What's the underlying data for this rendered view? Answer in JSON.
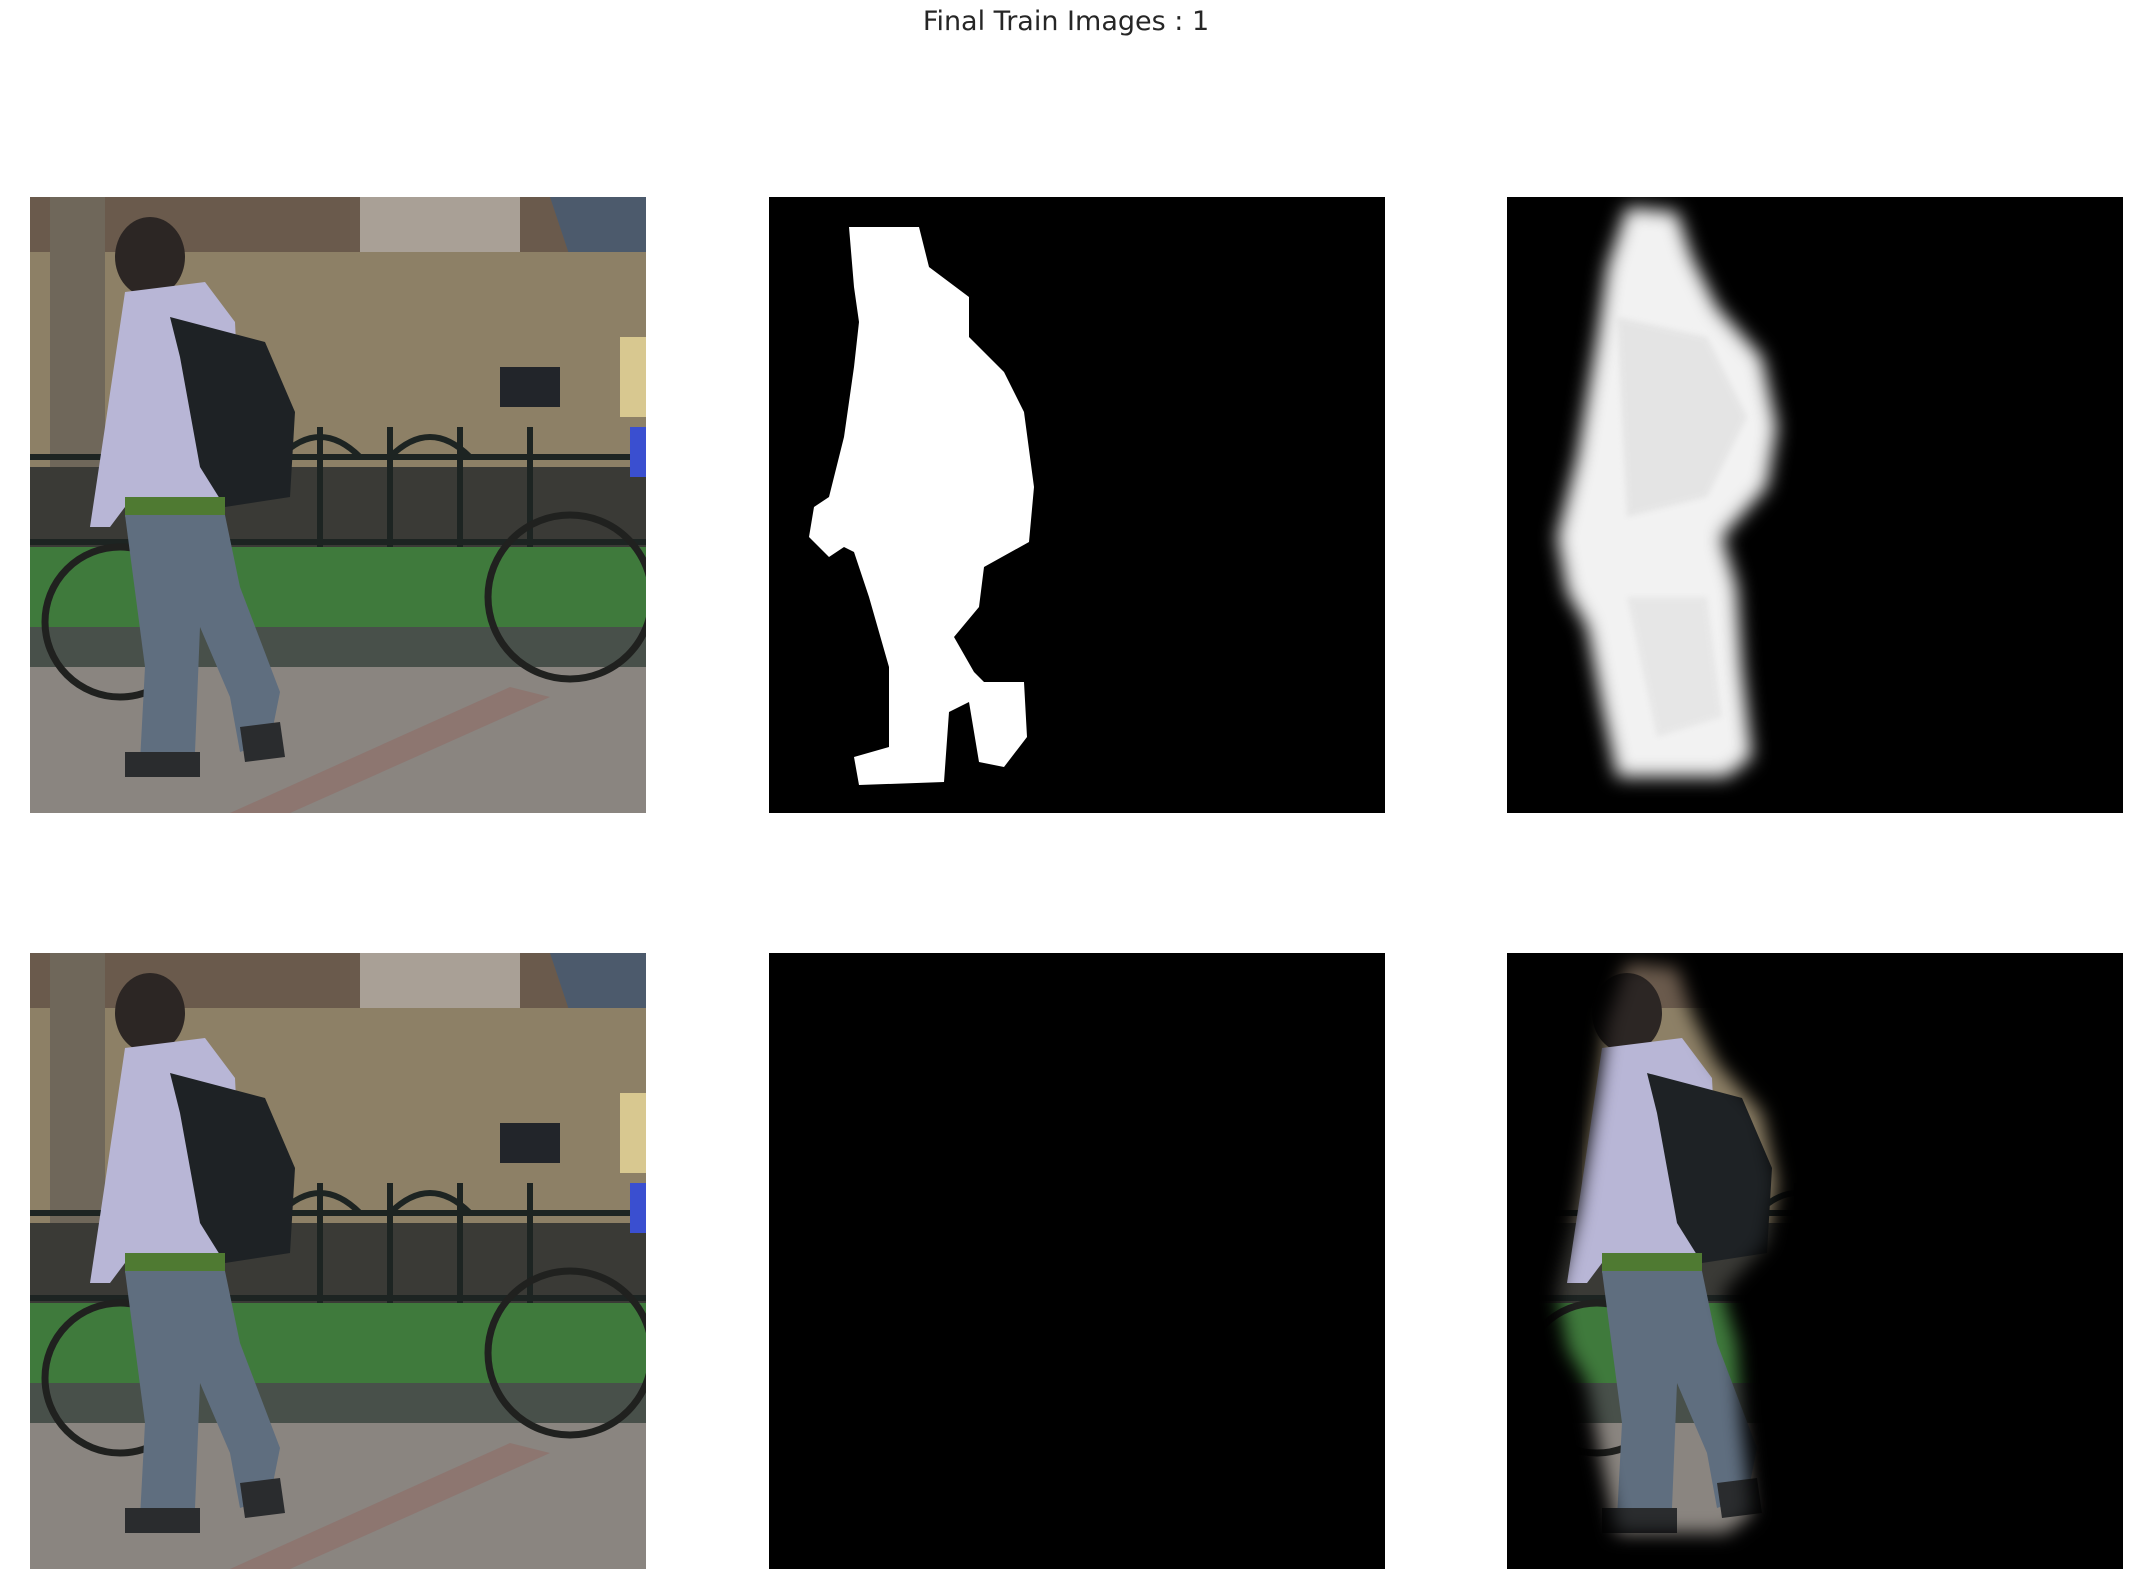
{
  "figure": {
    "title": "Final Train Images : 1"
  },
  "panels": [
    {
      "id": "input-image",
      "row": 1,
      "col": 1,
      "content": "photo"
    },
    {
      "id": "ground-truth-mask",
      "row": 1,
      "col": 2,
      "content": "binary-mask"
    },
    {
      "id": "predicted-mask",
      "row": 1,
      "col": 3,
      "content": "soft-mask"
    },
    {
      "id": "input-image-copy",
      "row": 2,
      "col": 1,
      "content": "photo"
    },
    {
      "id": "ground-truth-cutout",
      "row": 2,
      "col": 2,
      "content": "masked-photo"
    },
    {
      "id": "predicted-cutout",
      "row": 2,
      "col": 3,
      "content": "masked-photo-soft"
    }
  ],
  "colors": {
    "background": "#ffffff",
    "title": "#262626",
    "mask_fg": "#ffffff",
    "mask_bg": "#000000",
    "hoodie": "#b8b6d6",
    "jeans": "#5f6e7f",
    "wall": "#8d8066",
    "grass": "#3f7a3c",
    "pavement": "#8a8580"
  }
}
